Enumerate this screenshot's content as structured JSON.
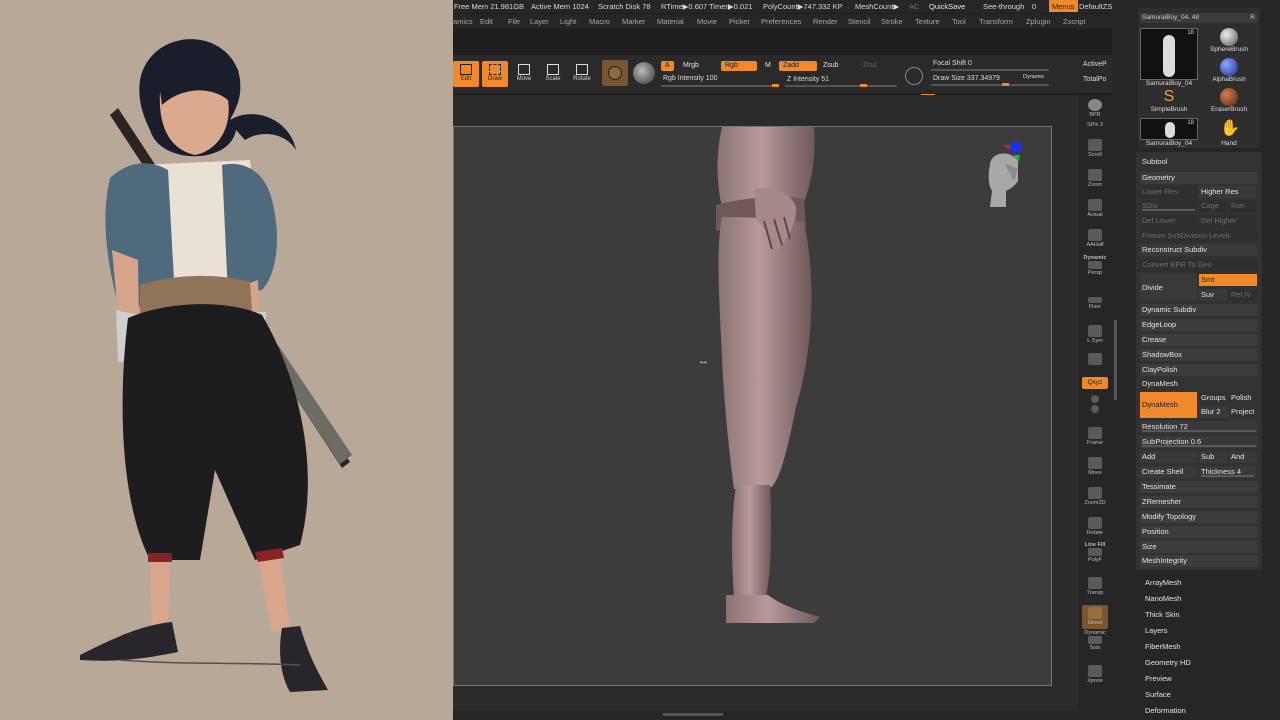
{
  "status": {
    "free_mem": "Free Mem 21.981GB",
    "active_mem": "Active Mem 1024",
    "scratch_disk": "Scratch Disk 78",
    "rtime": "RTime▶0.607",
    "timer": "Timer▶0.021",
    "polycount": "PolyCount▶747.332 KP",
    "meshcount": "MeshCount▶",
    "ac": "AC",
    "quicksave": "QuickSave",
    "see_through": "See-through",
    "see_through_value": "0",
    "menus": "Menus",
    "default_zscript": "DefaultZScript"
  },
  "menus": [
    "amics",
    "Edit",
    "File",
    "Layer",
    "Light",
    "Macro",
    "Marker",
    "Material",
    "Movie",
    "Picker",
    "Preferences",
    "Render",
    "Stencil",
    "Stroke",
    "Texture",
    "Tool",
    "Transform",
    "Zplugin",
    "Zscript"
  ],
  "shelf": {
    "edit": "Edit",
    "draw": "Draw",
    "move": "Move",
    "scale": "Scale",
    "rotate": "Rotate",
    "a": "A",
    "mrgb": "Mrgb",
    "rgb": "Rgb",
    "m": "M",
    "zadd": "Zadd",
    "zsub": "Zsub",
    "zcut": "Zcut",
    "rgb_intensity": "Rgb Intensity 100",
    "z_intensity": "Z Intensity 51",
    "focal_shift": "Focal Shift 0",
    "draw_size": "Draw Size 337.34979",
    "dynamic": "Dynamic",
    "active_points": "ActiveP",
    "total_points": "TotalPo"
  },
  "dock": {
    "bpr": "BPR",
    "spix": "SPix 3",
    "scroll": "Scroll",
    "zoom": "Zoom",
    "actual": "Actual",
    "aahalf": "AAHalf",
    "dynamic": "Dynamic",
    "persp": "Persp",
    "floor": "Floor",
    "lsym": "L.Sym",
    "qxyz": "Qxyz",
    "frame": "Frame",
    "move": "Move",
    "zoom3d": "Zoom3D",
    "rotate": "Rotate",
    "line_fill": "Line Fill",
    "polyf": "PolyF",
    "transp": "Transp",
    "ghost": "Ghost",
    "dynamic2": "Dynamic",
    "solo": "Solo",
    "xpose": "Xpose"
  },
  "brushes": {
    "top_name": "SamuraiBoy_04. 48",
    "top_r": "R",
    "items": [
      {
        "label": "SamuraiBoy_04",
        "num": "18"
      },
      {
        "label": "SphereBrush"
      },
      {
        "label": "AlphaBrush"
      },
      {
        "label": "SimpleBrush"
      },
      {
        "label": "EraserBrush"
      },
      {
        "label": "SamuraiBoy_04",
        "num": "18"
      },
      {
        "label": "Hand"
      }
    ]
  },
  "tool_panel": {
    "subtool": "Subtool",
    "geometry": "Geometry",
    "lower_res": "Lower Res",
    "higher_res": "Higher Res",
    "sdiv": "SDiv",
    "cage": "Cage",
    "rstr": "Rstr",
    "del_lower": "Del Lower",
    "del_higher": "Del Higher",
    "freeze_subdivision": "Freeze SubDivision Levels",
    "reconstruct_subdiv": "Reconstruct Subdiv",
    "convert_bpr": "Convert BPR To Geo",
    "divide": "Divide",
    "smt": "Smt",
    "suv": "Suv",
    "reuv": "ReUV",
    "dynamic_subdiv": "Dynamic Subdiv",
    "edgeloop": "EdgeLoop",
    "crease": "Crease",
    "shadowbox": "ShadowBox",
    "claypolish": "ClayPolish",
    "dynamesh_section": "DynaMesh",
    "dynamesh_button": "DynaMesh",
    "groups": "Groups",
    "polish": "Polish",
    "blur": "Blur 2",
    "project": "Project",
    "resolution": "Resolution 72",
    "subprojection": "SubProjection 0.6",
    "add": "Add",
    "sub": "Sub",
    "and": "And",
    "create_shell": "Create Shell",
    "thickness": "Thickness 4",
    "tessimate": "Tessimate",
    "zremesher": "ZRemesher",
    "modify_topology": "Modify Topology",
    "position": "Position",
    "size": "Size",
    "meshintegrity": "MeshIntegrity"
  },
  "sections": [
    "ArrayMesh",
    "NanoMesh",
    "Thick Skin",
    "Layers",
    "FiberMesh",
    "Geometry HD",
    "Preview",
    "Surface",
    "Deformation"
  ],
  "colors": {
    "accent": "#f0892c",
    "panel": "#323232",
    "background": "#1f1f1f",
    "canvas": "#3c3c3c"
  }
}
